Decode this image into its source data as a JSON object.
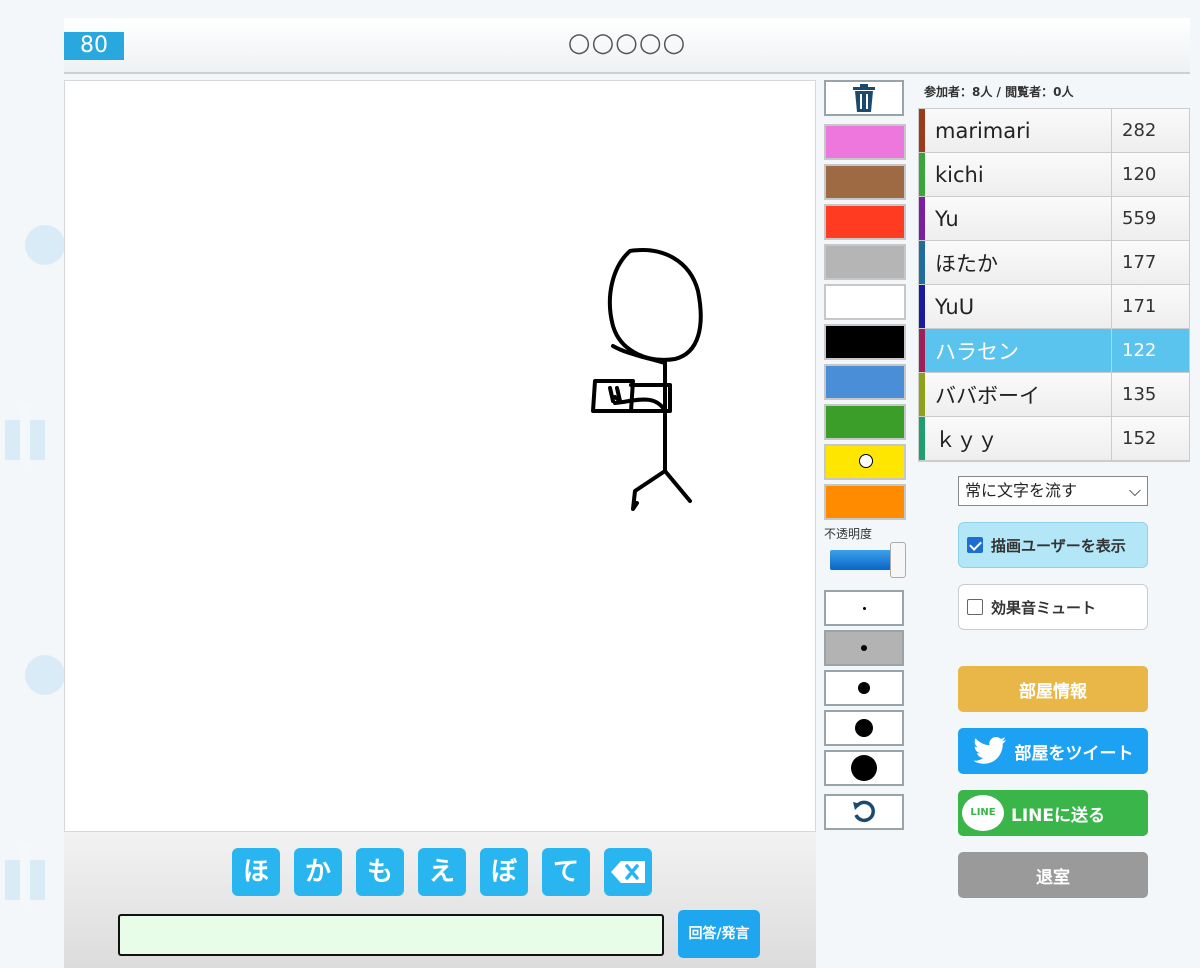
{
  "header": {
    "timer": "80",
    "hint": "○○○○○"
  },
  "tools": {
    "colors": [
      {
        "name": "pink",
        "hex": "#ee77dd"
      },
      {
        "name": "brown",
        "hex": "#9e6a43"
      },
      {
        "name": "red",
        "hex": "#ff3b22"
      },
      {
        "name": "gray",
        "hex": "#b5b5b5"
      },
      {
        "name": "white",
        "hex": "#ffffff"
      },
      {
        "name": "black",
        "hex": "#000000"
      },
      {
        "name": "blue",
        "hex": "#4a8ed8"
      },
      {
        "name": "green",
        "hex": "#3a9e28"
      },
      {
        "name": "yellow",
        "hex": "#ffe600",
        "selected": true
      },
      {
        "name": "orange",
        "hex": "#ff8c00"
      }
    ],
    "opacity_label": "不透明度",
    "opacity_value": 1.0,
    "pen_sizes": [
      "1",
      "2",
      "3",
      "4",
      "5"
    ],
    "selected_pen": "2",
    "icons": {
      "trash": "trash-icon",
      "undo": "undo-icon"
    }
  },
  "sidebar": {
    "counts": "参加者：8人 / 閲覧者：0人",
    "players": [
      {
        "name": "marimari",
        "score": "282",
        "color": "#9b3b1a"
      },
      {
        "name": "kichi",
        "score": "120",
        "color": "#3aa53a"
      },
      {
        "name": "Yu",
        "score": "559",
        "color": "#7a1fa0"
      },
      {
        "name": "ほたか",
        "score": "177",
        "color": "#1f6f9e"
      },
      {
        "name": "YuU",
        "score": "171",
        "color": "#1a1a9e"
      },
      {
        "name": "ハラセン",
        "score": "122",
        "color": "#9e1f5a",
        "active": true
      },
      {
        "name": "ババボーイ",
        "score": "135",
        "color": "#8fa01a"
      },
      {
        "name": "ｋｙｙ",
        "score": "152",
        "color": "#1f9e6f"
      }
    ],
    "text_flow_select": "常に文字を流す",
    "show_drawer": {
      "label": "描画ユーザーを表示",
      "checked": true
    },
    "mute_sfx": {
      "label": "効果音ミュート",
      "checked": false
    },
    "buttons": {
      "room_info": "部屋情報",
      "tweet": "部屋をツイート",
      "line": "LINEに送る",
      "line_icon_text": "LINE",
      "leave": "退室"
    }
  },
  "bottom": {
    "kana": [
      "ほ",
      "か",
      "も",
      "え",
      "ぼ",
      "て"
    ],
    "backspace_icon": "backspace-icon",
    "answer_value": "",
    "answer_button": "回答/発言"
  }
}
